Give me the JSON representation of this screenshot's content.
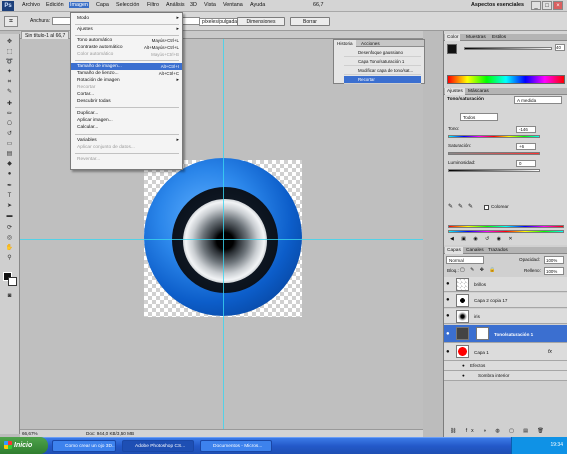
{
  "menubar": {
    "items": [
      "Archivo",
      "Edición",
      "Imagen",
      "Capa",
      "Selección",
      "Filtro",
      "Análisis",
      "3D",
      "Vista",
      "Ventana",
      "Ayuda"
    ],
    "zoom": "66,7",
    "workspace": "Aspectos esenciales"
  },
  "options": {
    "width_label": "Anchura:",
    "resolution_value": "píxeles/pulgada",
    "dims_button": "Dimensiones",
    "clear_button": "Borrar"
  },
  "document": {
    "tab_title": "Sin título-1 al 66,7",
    "zoom": "66,67%",
    "doc_size": "Doc: 944,0 KB/3,50 MB"
  },
  "image_menu": {
    "items": [
      {
        "label": "Modo",
        "shortcut": "",
        "submenu": true,
        "disabled": false
      },
      {
        "label": "Ajustes",
        "shortcut": "",
        "submenu": true,
        "disabled": false
      },
      {
        "label": "Tono automático",
        "shortcut": "Mayús+Ctrl+L",
        "submenu": false,
        "disabled": false
      },
      {
        "label": "Contraste automático",
        "shortcut": "Alt+Mayús+Ctrl+L",
        "submenu": false,
        "disabled": false
      },
      {
        "label": "Color automático",
        "shortcut": "Mayús+Ctrl+B",
        "submenu": false,
        "disabled": true
      },
      {
        "label": "Tamaño de imagen...",
        "shortcut": "Alt+Ctrl+I",
        "submenu": false,
        "disabled": false,
        "highlighted": true
      },
      {
        "label": "Tamaño de lienzo...",
        "shortcut": "Alt+Ctrl+C",
        "submenu": false,
        "disabled": false
      },
      {
        "label": "Rotación de imagen",
        "shortcut": "",
        "submenu": true,
        "disabled": false
      },
      {
        "label": "Recortar",
        "shortcut": "",
        "submenu": false,
        "disabled": true
      },
      {
        "label": "Cortar...",
        "shortcut": "",
        "submenu": false,
        "disabled": false
      },
      {
        "label": "Descubrir todas",
        "shortcut": "",
        "submenu": false,
        "disabled": false
      },
      {
        "label": "Duplicar...",
        "shortcut": "",
        "submenu": false,
        "disabled": false
      },
      {
        "label": "Aplicar imagen...",
        "shortcut": "",
        "submenu": false,
        "disabled": false
      },
      {
        "label": "Calcular...",
        "shortcut": "",
        "submenu": false,
        "disabled": false
      },
      {
        "label": "Variables",
        "shortcut": "",
        "submenu": true,
        "disabled": false
      },
      {
        "label": "Aplicar conjunto de datos...",
        "shortcut": "",
        "submenu": false,
        "disabled": true
      },
      {
        "label": "Reventar...",
        "shortcut": "",
        "submenu": false,
        "disabled": true
      }
    ]
  },
  "history": {
    "tabs": [
      "Historia",
      "Acciones"
    ],
    "rows": [
      "Desenfoque gaussiano",
      "Capa Tono/saturación 1",
      "Modificar capa de tono/sat...",
      "Recortar"
    ]
  },
  "color_panel": {
    "tabs": [
      "Color",
      "Muestras",
      "Estilos"
    ],
    "value": "40"
  },
  "adjust_panel": {
    "tabs": [
      "Ajustes",
      "Máscaras"
    ],
    "title": "Tono/saturación",
    "preset": "A medida",
    "channel": "Todos",
    "hue_label": "Tono:",
    "hue_value": "-146",
    "sat_label": "Saturación:",
    "sat_value": "+6",
    "light_label": "Luminosidad:",
    "light_value": "0",
    "colorize_label": "Colorear"
  },
  "layers_panel": {
    "tabs": [
      "Capas",
      "Canales",
      "Trazados"
    ],
    "blend_mode": "Normal",
    "opacity_label": "Opacidad:",
    "opacity_value": "100%",
    "lock_label": "Bloq.:",
    "fill_label": "Relleno:",
    "fill_value": "100%",
    "effects_label": "Efectos",
    "inner_shadow_label": "Sombra interior",
    "layers": [
      {
        "name": "brillos",
        "selected": false
      },
      {
        "name": "Capa 2 copia 17",
        "selected": false
      },
      {
        "name": "iris",
        "selected": false
      },
      {
        "name": "Tono/saturación 1",
        "selected": true
      },
      {
        "name": "Capa 1",
        "selected": false
      }
    ]
  },
  "taskbar": {
    "start_label": "Inicio",
    "buttons": [
      "Como crear un ojo 3D...",
      "Adobe Photoshop CS...",
      "Documentos - Micros..."
    ],
    "clock": "19:34"
  }
}
